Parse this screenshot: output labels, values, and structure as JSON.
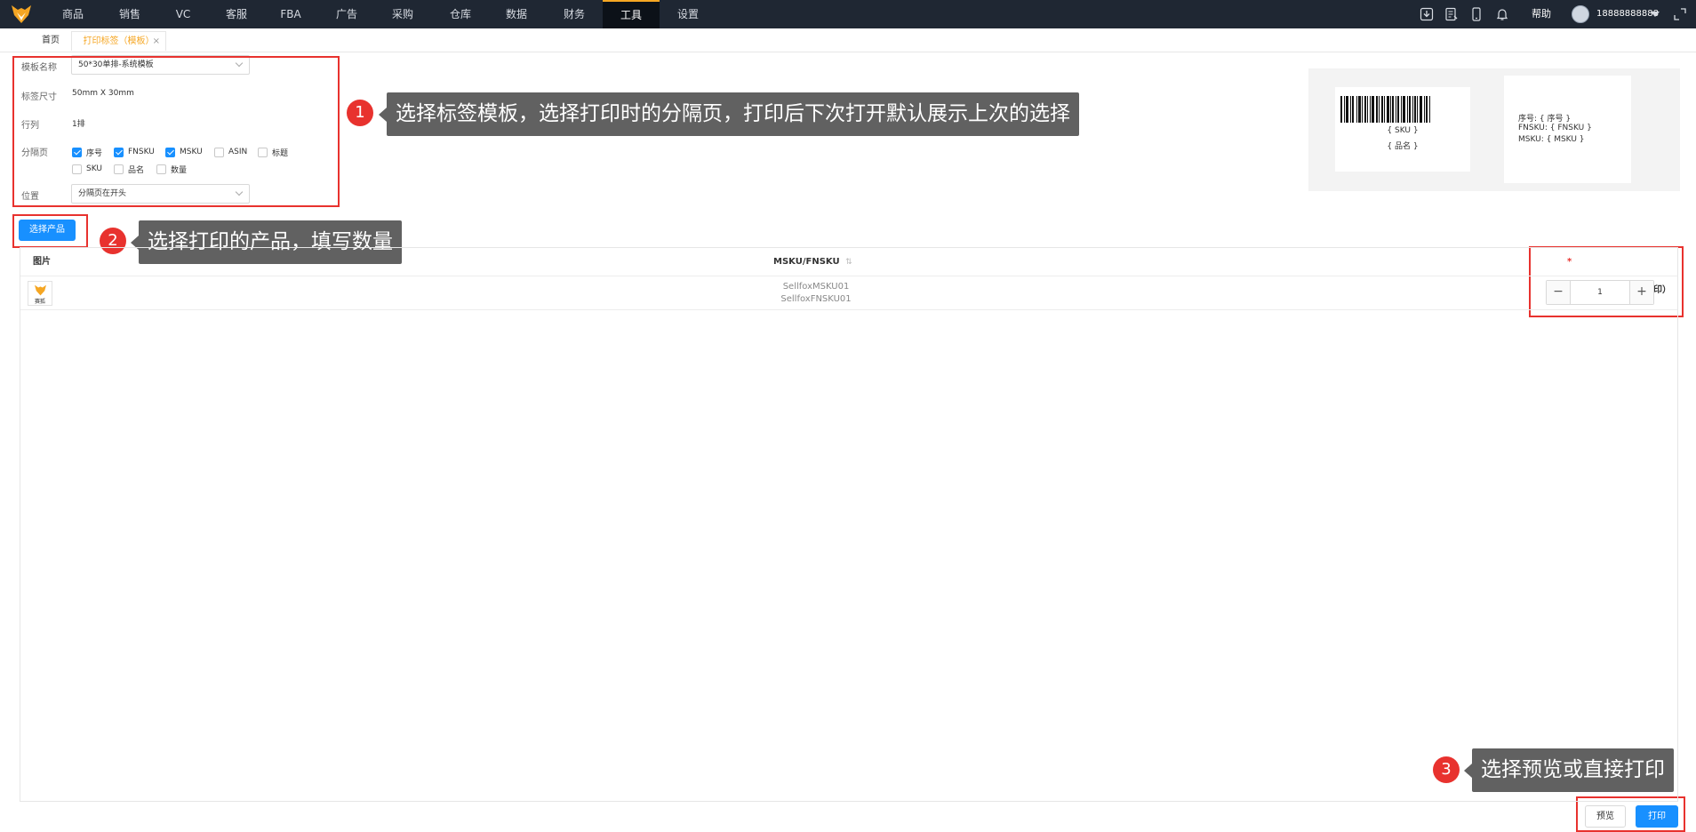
{
  "nav": {
    "items": [
      "商品",
      "销售",
      "VC",
      "客服",
      "FBA",
      "广告",
      "采购",
      "仓库",
      "数据",
      "财务",
      "工具",
      "设置"
    ],
    "active": "工具",
    "help": "帮助",
    "user_phone": "18888888888"
  },
  "tabs": {
    "home": "首页",
    "active": "打印标签（模板）",
    "close": "×"
  },
  "form": {
    "template_label": "模板名称",
    "template_value": "50*30单排-系统模板",
    "size_label": "标签尺寸",
    "size_value": "50mm X 30mm",
    "rows_label": "行列",
    "rows_value": "1排",
    "separator_label": "分隔页",
    "checkboxes": [
      {
        "label": "序号",
        "checked": true
      },
      {
        "label": "FNSKU",
        "checked": true
      },
      {
        "label": "MSKU",
        "checked": true
      },
      {
        "label": "ASIN",
        "checked": false
      },
      {
        "label": "标题",
        "checked": false
      },
      {
        "label": "SKU",
        "checked": false
      },
      {
        "label": "品名",
        "checked": false
      },
      {
        "label": "数量",
        "checked": false
      }
    ],
    "position_label": "位置",
    "position_value": "分隔页在开头"
  },
  "preview": {
    "sku_placeholder": "{ SKU }",
    "name_placeholder": "{ 品名 }",
    "sep_line1": "序号: { 序号 }",
    "sep_line2": "FNSKU: { FNSKU }",
    "sep_line3": "MSKU: { MSKU }"
  },
  "select_product_button": "选择产品",
  "table": {
    "col_image": "图片",
    "col_msku": "MSKU/FNSKU",
    "col_qty_required": "*",
    "col_qty": "打印数量（为0则不打印）",
    "rows": [
      {
        "msku": "SellfoxMSKU01",
        "fnsku": "SellfoxFNSKU01",
        "qty": "1",
        "thumb_text": "赛狐"
      }
    ]
  },
  "callouts": [
    {
      "num": "1",
      "text": "选择标签模板，选择打印时的分隔页，打印后下次打开默认展示上次的选择"
    },
    {
      "num": "2",
      "text": "选择打印的产品，填写数量"
    },
    {
      "num": "3",
      "text": "选择预览或直接打印"
    }
  ],
  "footer": {
    "preview_button": "预览",
    "print_button": "打印"
  },
  "colors": {
    "nav_bg": "#1f2733",
    "accent": "#f5a623",
    "primary": "#1890ff",
    "annotation_red": "#e8322e",
    "callout_bg": "#616161"
  }
}
